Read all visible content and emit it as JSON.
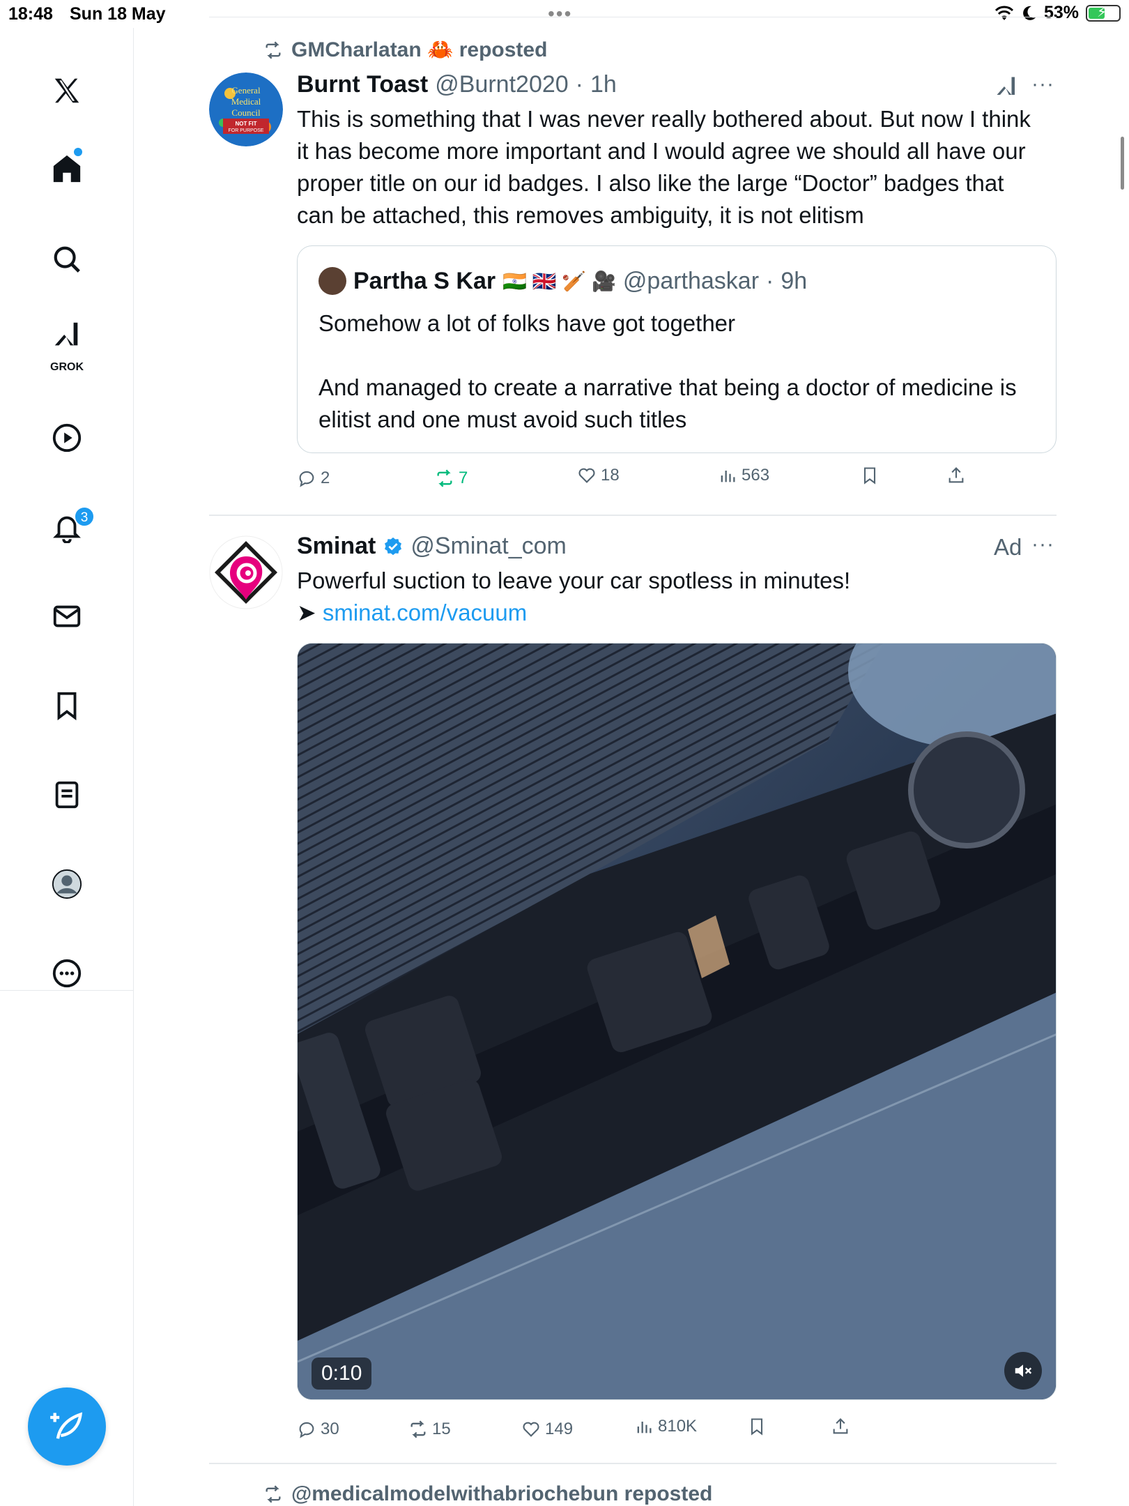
{
  "status": {
    "time": "18:48",
    "date": "Sun 18 May",
    "battery": "53%"
  },
  "sidebar": {
    "grok_label": "GROK",
    "notifications_count": "3"
  },
  "post1": {
    "repost_by": "GMCharlatan 🦀 reposted",
    "avatar_text": [
      "General",
      "Medical",
      "Council",
      "NOT FIT",
      "FOR PURPOSE"
    ],
    "name": "Burnt Toast",
    "handle": "@Burnt2020",
    "time": "1h",
    "text": "This is something that I was never really bothered about. But now I think it has become more important and I would agree we should all have our proper title on our id badges. I also like the large “Doctor” badges that can be attached, this removes ambiguity, it is not elitism",
    "quote": {
      "name": "Partha S Kar",
      "emojis": "🇮🇳 🇬🇧 🏏 🎥",
      "handle": "@parthaskar",
      "time": "9h",
      "text_line1": "Somehow a lot of folks have got together",
      "text_line2": "And managed to create a narrative that being a doctor of medicine is elitist and one must avoid such titles"
    },
    "actions": {
      "replies": "2",
      "reposts": "7",
      "likes": "18",
      "views": "563"
    }
  },
  "post2": {
    "name": "Sminat",
    "handle": "@Sminat_com",
    "ad_label": "Ad",
    "text": "Powerful suction to leave your car spotless in minutes!",
    "link_prefix": "➤",
    "link": "sminat.com/vacuum",
    "video_time": "0:10",
    "actions": {
      "replies": "30",
      "reposts": "15",
      "likes": "149",
      "views": "810K"
    }
  },
  "post3": {
    "repost_by": "@medicalmodelwithabriochebun reposted"
  },
  "colors": {
    "accent": "#1d9bf0",
    "repost_green": "#00ba7c",
    "muted": "#536471"
  }
}
